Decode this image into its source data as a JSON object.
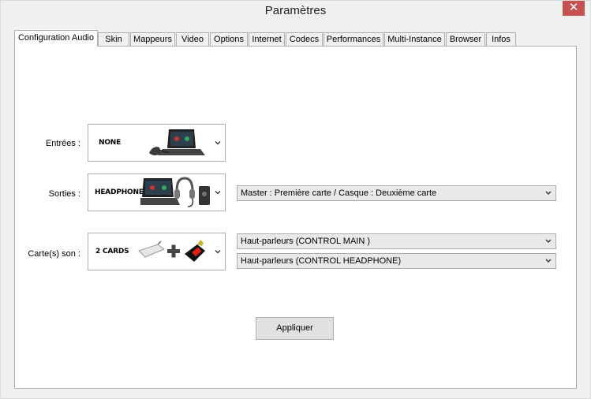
{
  "window": {
    "title": "Paramètres",
    "close_glyph": "✕"
  },
  "tabs": [
    {
      "label": "Configuration Audio",
      "active": true
    },
    {
      "label": "Skin"
    },
    {
      "label": "Mappeurs"
    },
    {
      "label": "Video"
    },
    {
      "label": "Options"
    },
    {
      "label": "Internet"
    },
    {
      "label": "Codecs"
    },
    {
      "label": "Performances"
    },
    {
      "label": "Multi-Instance"
    },
    {
      "label": "Browser"
    },
    {
      "label": "Infos"
    }
  ],
  "audio": {
    "inputs": {
      "label": "Entrées :",
      "image_caption": "NONE"
    },
    "outputs": {
      "label": "Sorties :",
      "image_caption": "HEADPHONES",
      "mode_value": "Master : Première carte / Casque : Deuxième carte"
    },
    "soundcards": {
      "label": "Carte(s) son :",
      "image_caption": "2 CARDS",
      "card1_value": "Haut-parleurs (CONTROL MAIN )",
      "card2_value": "Haut-parleurs (CONTROL HEADPHONE)"
    },
    "apply_label": "Appliquer"
  }
}
